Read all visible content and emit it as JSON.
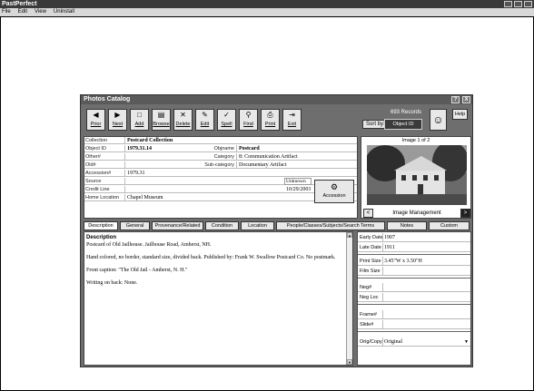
{
  "app": {
    "title": "PastPerfect"
  },
  "menu": [
    "File",
    "Edit",
    "View",
    "Uninstall"
  ],
  "dialog": {
    "title": "Photos Catalog",
    "help_glyph": "?",
    "close_glyph": "X"
  },
  "toolbar": {
    "buttons": [
      "Prior",
      "Next",
      "Add",
      "Browse",
      "Delete",
      "Edit",
      "Spell",
      "Find",
      "Print",
      "Exit"
    ],
    "records": "693 Records",
    "sort_label": "Sort by:",
    "sort_value": "Object ID",
    "help": "Help"
  },
  "fields": {
    "collection_label": "Collection",
    "collection": "Postcard Collection",
    "objectid_label": "Object ID",
    "objectid": "1979.31.14",
    "objname_label": "Objname",
    "objname": "Postcard",
    "other_label": "Other#",
    "category_label": "Category",
    "category": "8: Communication Artifact",
    "old_label": "Old#",
    "subcategory_label": "Sub-category",
    "subcategory": "Documentary Artifact",
    "accession_label": "Accession#",
    "accession": "1979.31",
    "source_label": "Source",
    "source_status": "Unknown",
    "creditline_label": "Credit Line",
    "date": "10/29/2003",
    "homeloc_label": "Home Location",
    "homeloc": "Chapel Museum",
    "accession_button": "Accession"
  },
  "image": {
    "label": "Image 1 of 2",
    "management": "Image Management",
    "prev": "<",
    "next": ">"
  },
  "tabs": [
    "Description",
    "General",
    "Provenance/Related",
    "Condition",
    "Location",
    "People/Classes/Subjects/Search Terms",
    "Notes",
    "Custom"
  ],
  "description": {
    "heading": "Description",
    "paragraphs": [
      "Postcard of Old Jailhouse. Jailhouse Road, Amherst, NH.",
      "Hand colored, no border, standard size, divided back. Published by: Frank W. Swallow Postcard Co. No postmark.",
      "Front caption: \"The Old Jail - Amherst, N. H.\"",
      "Writing on back: None."
    ]
  },
  "details": {
    "early_label": "Early Date",
    "early": "1907",
    "late_label": "Late Date",
    "late": "1911",
    "printsize_label": "Print Size",
    "printsize": "3.45\"W x 3.50\"H",
    "filmsize_label": "Film Size",
    "neg_label": "Neg#",
    "negloc_label": "Neg Loc",
    "frame_label": "Frame#",
    "slide_label": "Slide#",
    "origcopy_label": "Orig/Copy",
    "origcopy": "Original"
  }
}
